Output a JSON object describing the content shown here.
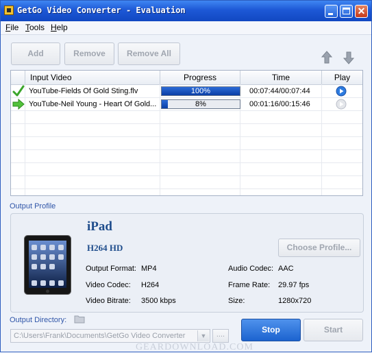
{
  "window": {
    "title": "GetGo Video Converter - Evaluation"
  },
  "menu": [
    {
      "label": "File",
      "underline": "F",
      "rest": "ile"
    },
    {
      "label": "Tools",
      "underline": "T",
      "rest": "ools"
    },
    {
      "label": "Help",
      "underline": "H",
      "rest": "elp"
    }
  ],
  "toolbar": {
    "add_label": "Add",
    "remove_label": "Remove",
    "remove_all_label": "Remove All"
  },
  "table": {
    "headers": [
      "Input Video",
      "Progress",
      "Time",
      "Play"
    ],
    "rows": [
      {
        "name": "YouTube-Fields Of Gold Sting.flv",
        "progress": 100,
        "progress_label": "100%",
        "time": "00:07:44/00:07:44",
        "status": "done",
        "play_enabled": true
      },
      {
        "name": "YouTube-Neil Young - Heart Of Gold...",
        "progress": 8,
        "progress_label": "8%",
        "time": "00:01:16/00:15:46",
        "status": "converting",
        "play_enabled": false
      }
    ]
  },
  "output_profile": {
    "section_label": "Output Profile",
    "device": "iPad",
    "profile": "H264 HD",
    "choose_label": "Choose Profile...",
    "specs": {
      "output_format_label": "Output Format:",
      "output_format": "MP4",
      "video_codec_label": "Video Codec:",
      "video_codec": "H264",
      "video_bitrate_label": "Video Bitrate:",
      "video_bitrate": "3500 kbps",
      "audio_codec_label": "Audio Codec:",
      "audio_codec": "AAC",
      "frame_rate_label": "Frame Rate:",
      "frame_rate": "29.97 fps",
      "size_label": "Size:",
      "size": "1280x720"
    }
  },
  "output_directory": {
    "label": "Output Directory:",
    "path": "C:\\Users\\Frank\\Documents\\GetGo Video Converter",
    "browse_label": "...."
  },
  "actions": {
    "stop_label": "Stop",
    "start_label": "Start"
  },
  "watermark": "GEARDOWNLOAD.COM",
  "colors": {
    "accent": "#1c63cf",
    "progress": "#0a3ea5",
    "check": "#3aa52a",
    "label_blue": "#2f55a8"
  }
}
